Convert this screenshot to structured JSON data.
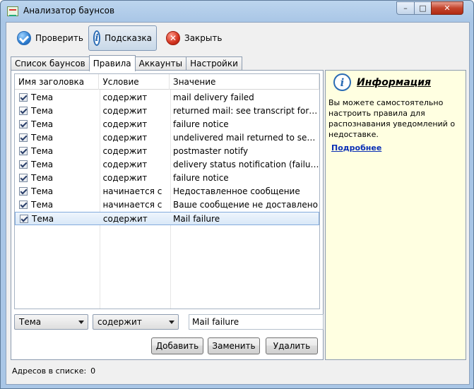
{
  "window": {
    "title": "Анализатор баунсов",
    "minimize": "–",
    "maximize": "□",
    "close": "✕"
  },
  "toolbar": {
    "check_label": "Проверить",
    "hint_label": "Подсказка",
    "close_label": "Закрыть"
  },
  "tabs": [
    "Список баунсов",
    "Правила",
    "Аккаунты",
    "Настройки"
  ],
  "grid": {
    "headers": [
      "Имя заголовка",
      "Условие",
      "Значение"
    ],
    "rows": [
      {
        "field": "Тема",
        "condition": "содержит",
        "value": "mail delivery failed"
      },
      {
        "field": "Тема",
        "condition": "содержит",
        "value": "returned mail: see transcript for det..."
      },
      {
        "field": "Тема",
        "condition": "содержит",
        "value": "failure notice"
      },
      {
        "field": "Тема",
        "condition": "содержит",
        "value": "undelivered mail returned to sender"
      },
      {
        "field": "Тема",
        "condition": "содержит",
        "value": "postmaster notify"
      },
      {
        "field": "Тема",
        "condition": "содержит",
        "value": "delivery status notification (failure)"
      },
      {
        "field": "Тема",
        "condition": "содержит",
        "value": "failure notice"
      },
      {
        "field": "Тема",
        "condition": "начинается с",
        "value": "Недоставленное сообщение"
      },
      {
        "field": "Тема",
        "condition": "начинается с",
        "value": "Ваше сообщение не доставлено"
      },
      {
        "field": "Тема",
        "condition": "содержит",
        "value": "Mail failure"
      }
    ]
  },
  "editor": {
    "field_value": "Тема",
    "condition_value": "содержит",
    "text_value": "Mail failure"
  },
  "buttons": {
    "add": "Добавить",
    "replace": "Заменить",
    "delete": "Удалить"
  },
  "info": {
    "title": "Информация",
    "text": "Вы можете самостоятельно настроить правила для распознавания уведомлений о недоставке.",
    "link": "Подробнее"
  },
  "status": {
    "label": "Адресов в списке:",
    "count": "0"
  }
}
